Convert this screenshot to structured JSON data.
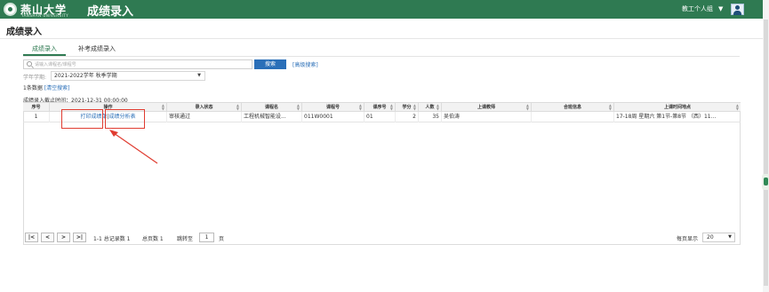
{
  "header": {
    "university_name": "燕山大学",
    "university_sub": "YANSHAN UNIVERSITY",
    "app_title": "成绩录入",
    "role": "教工个人组"
  },
  "page": {
    "title": "成绩录入"
  },
  "tabs": [
    {
      "label": "成绩录入",
      "active": true
    },
    {
      "label": "补考成绩录入",
      "active": false
    }
  ],
  "search": {
    "placeholder": "请输入课程名/课程号",
    "button": "搜索",
    "advanced": "[高级搜索]"
  },
  "filter": {
    "term_label": "学年学期:",
    "term_value": "2021-2022学年 秋季学期"
  },
  "result": {
    "count": "1条数据",
    "clear_link": "[清空搜索]",
    "deadline": "成绩录入截止时间：2021-12-31 00:00:00"
  },
  "table": {
    "headers": [
      "序号",
      "操作",
      "录入状态",
      "课程名",
      "课程号",
      "课序号",
      "学分",
      "人数",
      "上课教师",
      "合班信息",
      "上课时间地点"
    ],
    "rows": [
      {
        "index": "1",
        "op_print": "打印成绩单",
        "op_analysis": "成绩分析表",
        "status": "审核通过",
        "course_name": "工程机械智能设...",
        "course_no": "011W0001",
        "section": "01",
        "credit": "2",
        "students": "35",
        "teacher": "吴伯涛",
        "merged": "",
        "schedule": "17-18周 星期六 第1节-第8节 （西）11..."
      }
    ]
  },
  "pager": {
    "first": "|<",
    "prev": "<",
    "next": ">",
    "last": ">|",
    "summary": "1-1 总记录数 1",
    "total_pages": "总页数 1",
    "goto_label": "跳转至",
    "page_value": "1",
    "page_unit": "页",
    "page_size_label": "每页显示",
    "page_size": "20"
  },
  "colors": {
    "brand_green": "#2f7a52",
    "link_blue": "#2a6fb8",
    "annotation_red": "#e03c31"
  }
}
